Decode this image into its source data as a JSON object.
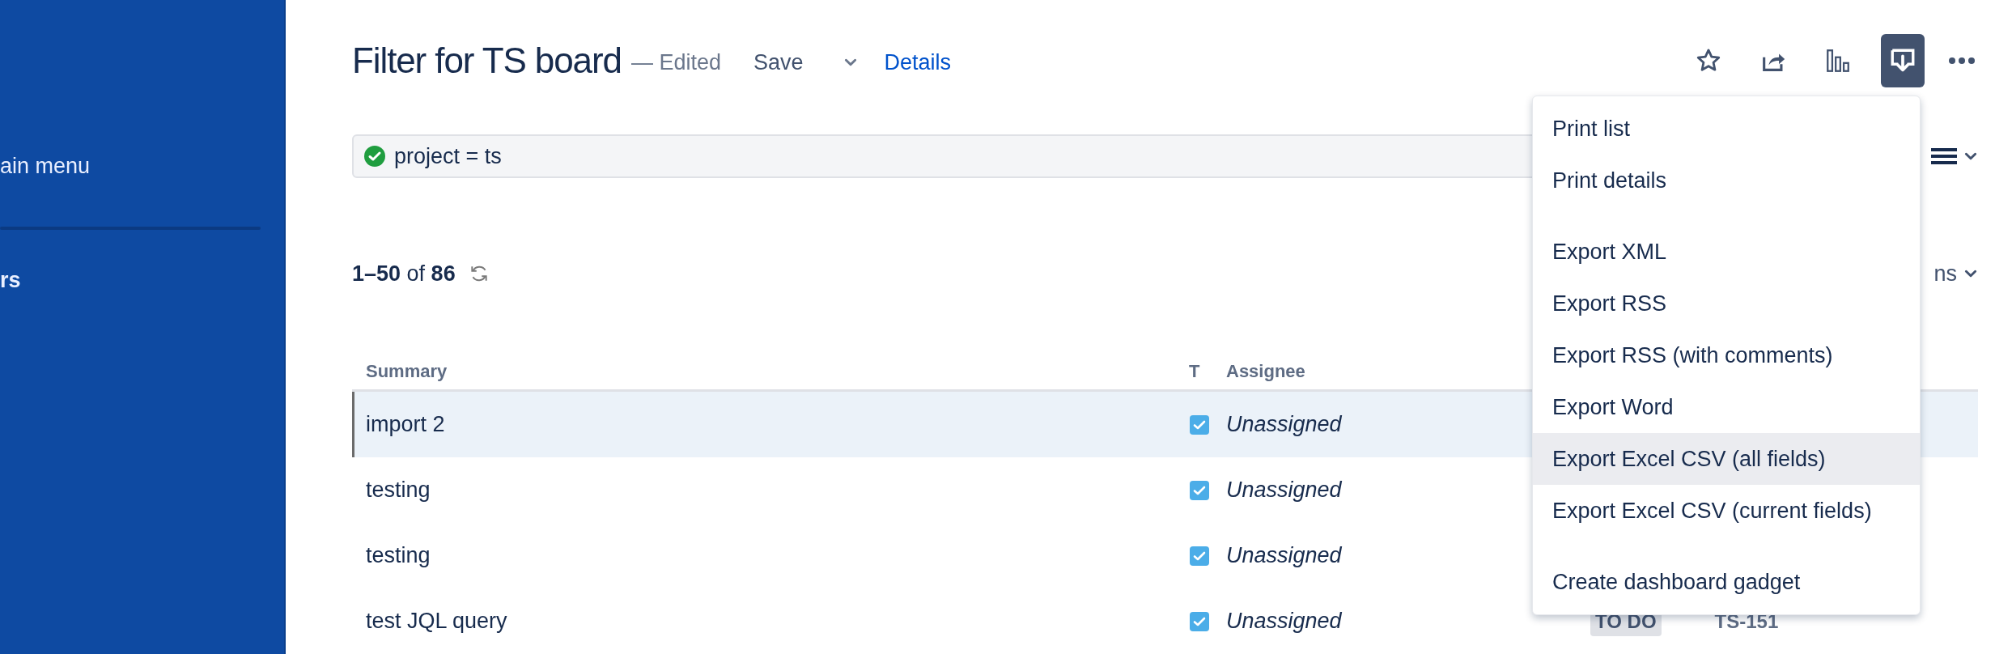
{
  "sidebar": {
    "items": [
      {
        "label": "ain menu",
        "bold": false
      },
      {
        "label": "rs",
        "bold": true
      }
    ]
  },
  "header": {
    "title": "Filter for TS board",
    "edited": "— Edited",
    "save": "Save",
    "details": "Details"
  },
  "toolbar": {
    "buttons": [
      {
        "kind": "star",
        "selected": false
      },
      {
        "kind": "share",
        "selected": false
      },
      {
        "kind": "charts",
        "selected": false
      },
      {
        "kind": "export",
        "selected": true
      }
    ]
  },
  "filter": {
    "query": "project = ts",
    "valid": true
  },
  "view_switcher": {
    "columns_tail": "ns"
  },
  "results": {
    "count": "**1–50** of **86**"
  },
  "table": {
    "columns": [
      "Summary",
      "T",
      "Assignee"
    ],
    "rows": [
      {
        "summary": "import 2",
        "assignee": "Unassigned",
        "selected": true
      },
      {
        "summary": "testing",
        "assignee": "Unassigned",
        "selected": false
      },
      {
        "summary": "testing",
        "assignee": "Unassigned",
        "selected": false
      },
      {
        "summary": "test JQL query",
        "assignee": "Unassigned",
        "selected": false,
        "status": "TO DO",
        "key": "TS-151"
      }
    ]
  },
  "export_menu": {
    "groups": [
      {
        "items": [
          {
            "label": "Print list",
            "highlighted": false
          },
          {
            "label": "Print details",
            "highlighted": false
          }
        ]
      },
      {
        "items": [
          {
            "label": "Export XML",
            "highlighted": false
          },
          {
            "label": "Export RSS",
            "highlighted": false
          },
          {
            "label": "Export RSS (with comments)",
            "highlighted": false
          },
          {
            "label": "Export Word",
            "highlighted": false
          },
          {
            "label": "Export Excel CSV (all fields)",
            "highlighted": true
          },
          {
            "label": "Export Excel CSV (current fields)",
            "highlighted": false
          }
        ]
      },
      {
        "items": [
          {
            "label": "Create dashboard gadget",
            "highlighted": false
          }
        ]
      }
    ]
  }
}
